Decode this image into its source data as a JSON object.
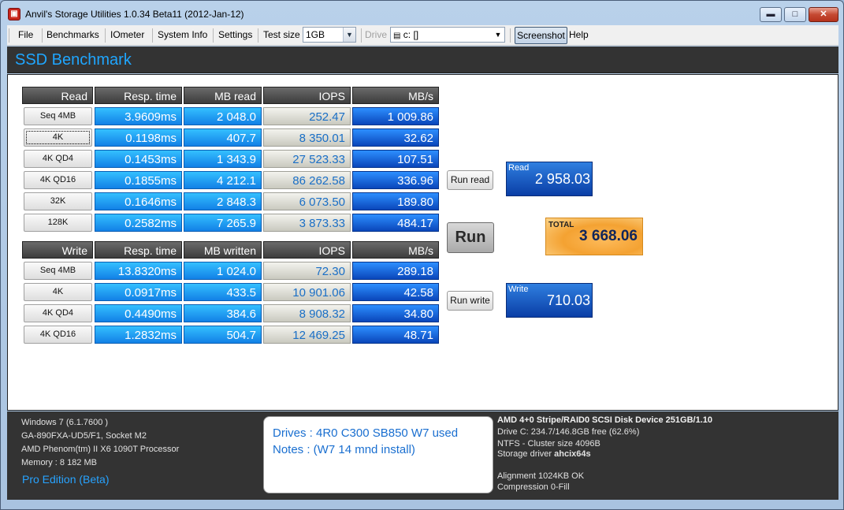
{
  "window": {
    "title": "Anvil's Storage Utilities 1.0.34 Beta11 (2012-Jan-12)",
    "icon": "toolbox-icon",
    "min": "minimize-icon",
    "max": "maximize-icon",
    "close": "close-icon"
  },
  "menu": {
    "file": "File",
    "benchmarks": "Benchmarks",
    "iometer": "IOmeter",
    "system_info": "System Info",
    "settings": "Settings",
    "test_size_label": "Test size",
    "test_size_value": "1GB",
    "drive_label": "Drive",
    "drive_value": "c: []",
    "screenshot": "Screenshot",
    "help": "Help"
  },
  "header": {
    "title": "SSD Benchmark"
  },
  "read_table": {
    "headers": [
      "Read",
      "Resp. time",
      "MB read",
      "IOPS",
      "MB/s"
    ],
    "rows": [
      {
        "label": "Seq 4MB",
        "resp": "3.9609ms",
        "mb": "2 048.0",
        "iops": "252.47",
        "mbs": "1 009.86"
      },
      {
        "label": "4K",
        "resp": "0.1198ms",
        "mb": "407.7",
        "iops": "8 350.01",
        "mbs": "32.62"
      },
      {
        "label": "4K QD4",
        "resp": "0.1453ms",
        "mb": "1 343.9",
        "iops": "27 523.33",
        "mbs": "107.51"
      },
      {
        "label": "4K QD16",
        "resp": "0.1855ms",
        "mb": "4 212.1",
        "iops": "86 262.58",
        "mbs": "336.96"
      },
      {
        "label": "32K",
        "resp": "0.1646ms",
        "mb": "2 848.3",
        "iops": "6 073.50",
        "mbs": "189.80"
      },
      {
        "label": "128K",
        "resp": "0.2582ms",
        "mb": "7 265.9",
        "iops": "3 873.33",
        "mbs": "484.17"
      }
    ]
  },
  "write_table": {
    "headers": [
      "Write",
      "Resp. time",
      "MB written",
      "IOPS",
      "MB/s"
    ],
    "rows": [
      {
        "label": "Seq 4MB",
        "resp": "13.8320ms",
        "mb": "1 024.0",
        "iops": "72.30",
        "mbs": "289.18"
      },
      {
        "label": "4K",
        "resp": "0.0917ms",
        "mb": "433.5",
        "iops": "10 901.06",
        "mbs": "42.58"
      },
      {
        "label": "4K QD4",
        "resp": "0.4490ms",
        "mb": "384.6",
        "iops": "8 908.32",
        "mbs": "34.80"
      },
      {
        "label": "4K QD16",
        "resp": "1.2832ms",
        "mb": "504.7",
        "iops": "12 469.25",
        "mbs": "48.71"
      }
    ]
  },
  "buttons": {
    "run_read": "Run read",
    "run": "Run",
    "run_write": "Run write"
  },
  "scores": {
    "read_label": "Read",
    "read_value": "2 958.03",
    "total_label": "TOTAL",
    "total_value": "3 668.06",
    "write_label": "Write",
    "write_value": "710.03"
  },
  "system": {
    "os": "Windows 7 (6.1.7600 )",
    "board": "GA-890FXA-UD5/F1, Socket M2",
    "cpu": "AMD Phenom(tm) II X6 1090T Processor",
    "memory": "Memory : 8 182 MB",
    "edition": "Pro Edition (Beta)"
  },
  "notes": {
    "drives": "Drives : 4R0 C300 SB850 W7 used",
    "notes": "Notes : (W7 14 mnd install)"
  },
  "disk": {
    "title": "AMD 4+0 Stripe/RAID0 SCSI Disk Device 251GB/1.10",
    "drive_c": "Drive C: 234.7/146.8GB free (62.6%)",
    "ntfs": "NTFS - Cluster size 4096B",
    "driver_label": "Storage driver",
    "driver_value": "ahcix64s",
    "alignment": "Alignment 1024KB OK",
    "compression": "Compression 0-Fill"
  },
  "colors": {
    "accent": "#1fa6ff",
    "cell_blue": "#1e90ff",
    "mbs_blue": "#0a46ba",
    "total_orange": "#f4a232"
  }
}
